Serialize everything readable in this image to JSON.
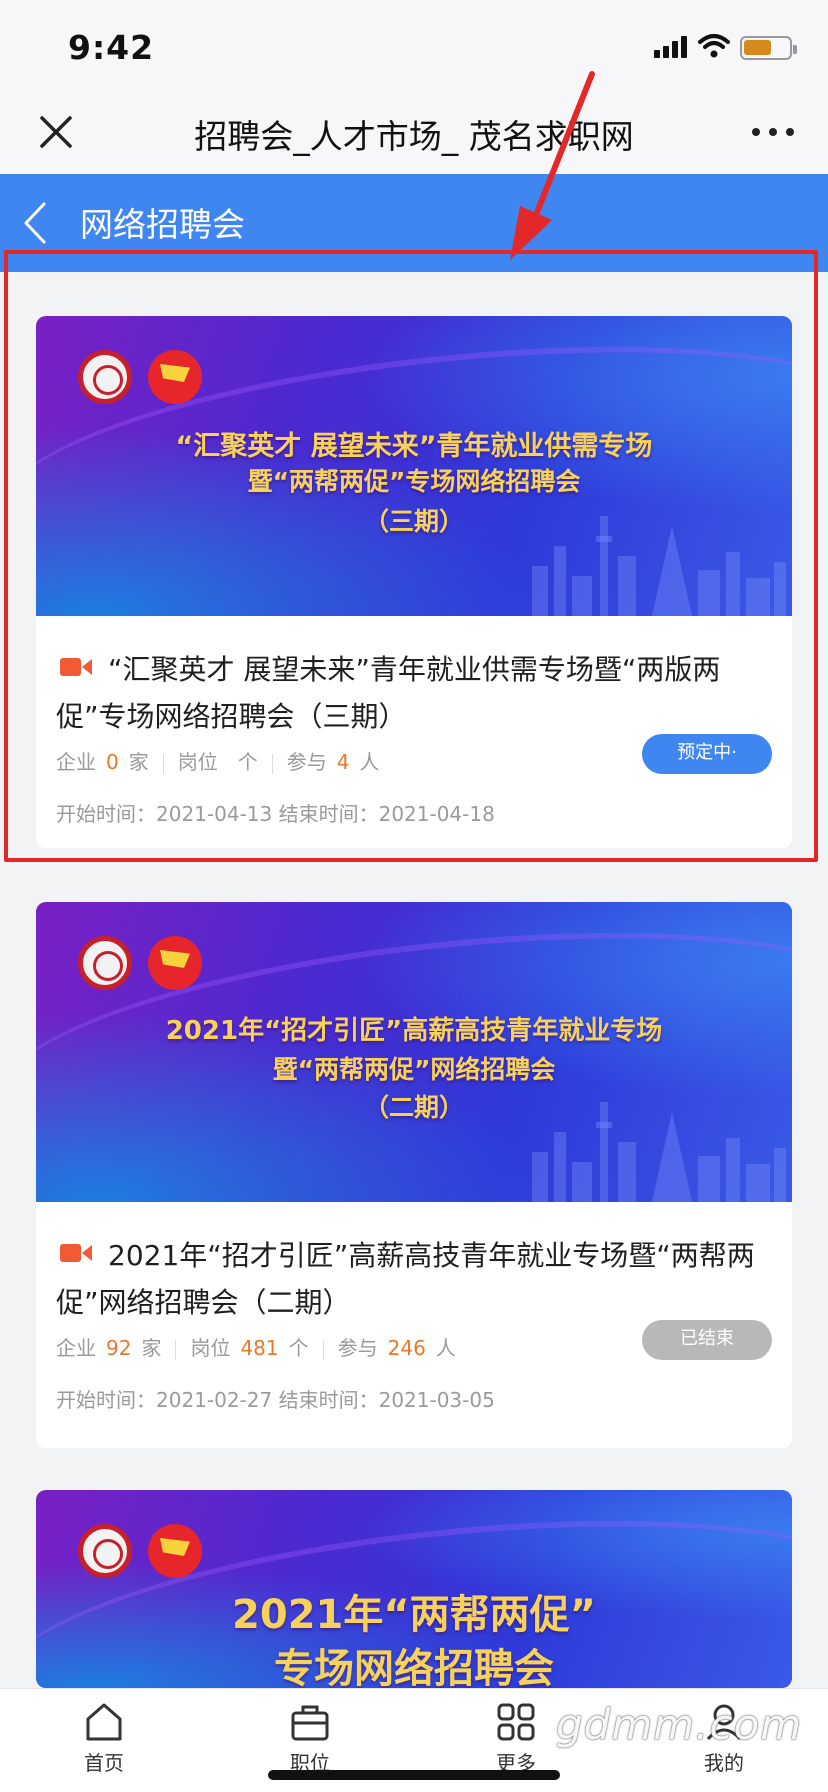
{
  "status_bar": {
    "time": "9:42"
  },
  "nav": {
    "title": "招聘会_人才市场_ 茂名求职网"
  },
  "sub_header": {
    "title": "网络招聘会"
  },
  "cards": [
    {
      "banner_lines": [
        "“汇聚英才 展望未来”青年就业供需专场",
        "暨“两帮两促”专场网络招聘会",
        "（三期）"
      ],
      "title": "“汇聚英才 展望未来”青年就业供需专场暨“两版两促”专场网络招聘会（三期）",
      "company_label": "企业",
      "company_count": "0",
      "company_unit": "家",
      "job_label": "岗位",
      "job_count": "",
      "job_unit": "个",
      "join_label": "参与",
      "join_count": "4",
      "join_unit": "人",
      "start_label": "开始时间：",
      "start": "2021-04-13",
      "end_label": "结束时间：",
      "end": "2021-04-18",
      "status": "预定中·"
    },
    {
      "banner_lines": [
        "2021年“招才引匠”高薪高技青年就业专场",
        "暨“两帮两促”网络招聘会",
        "（二期）"
      ],
      "title": "2021年“招才引匠”高薪高技青年就业专场暨“两帮两促”网络招聘会（二期）",
      "company_label": "企业",
      "company_count": "92",
      "company_unit": "家",
      "job_label": "岗位",
      "job_count": "481",
      "job_unit": "个",
      "join_label": "参与",
      "join_count": "246",
      "join_unit": "人",
      "start_label": "开始时间：",
      "start": "2021-02-27",
      "end_label": "结束时间：",
      "end": "2021-03-05",
      "status": "已结束"
    },
    {
      "banner_lines": [
        "2021年“两帮两促”",
        "专场网络招聘会"
      ]
    }
  ],
  "tabs": [
    {
      "label": "首页",
      "icon": "home-icon"
    },
    {
      "label": "职位",
      "icon": "briefcase-icon"
    },
    {
      "label": "更多",
      "icon": "grid-icon"
    },
    {
      "label": "我的",
      "icon": "user-icon"
    }
  ],
  "watermark": "gdmm.com",
  "colors": {
    "primary": "#3f86f0",
    "highlight": "#e3282a",
    "number": "#e6792b",
    "ended": "#b8b8b8"
  }
}
